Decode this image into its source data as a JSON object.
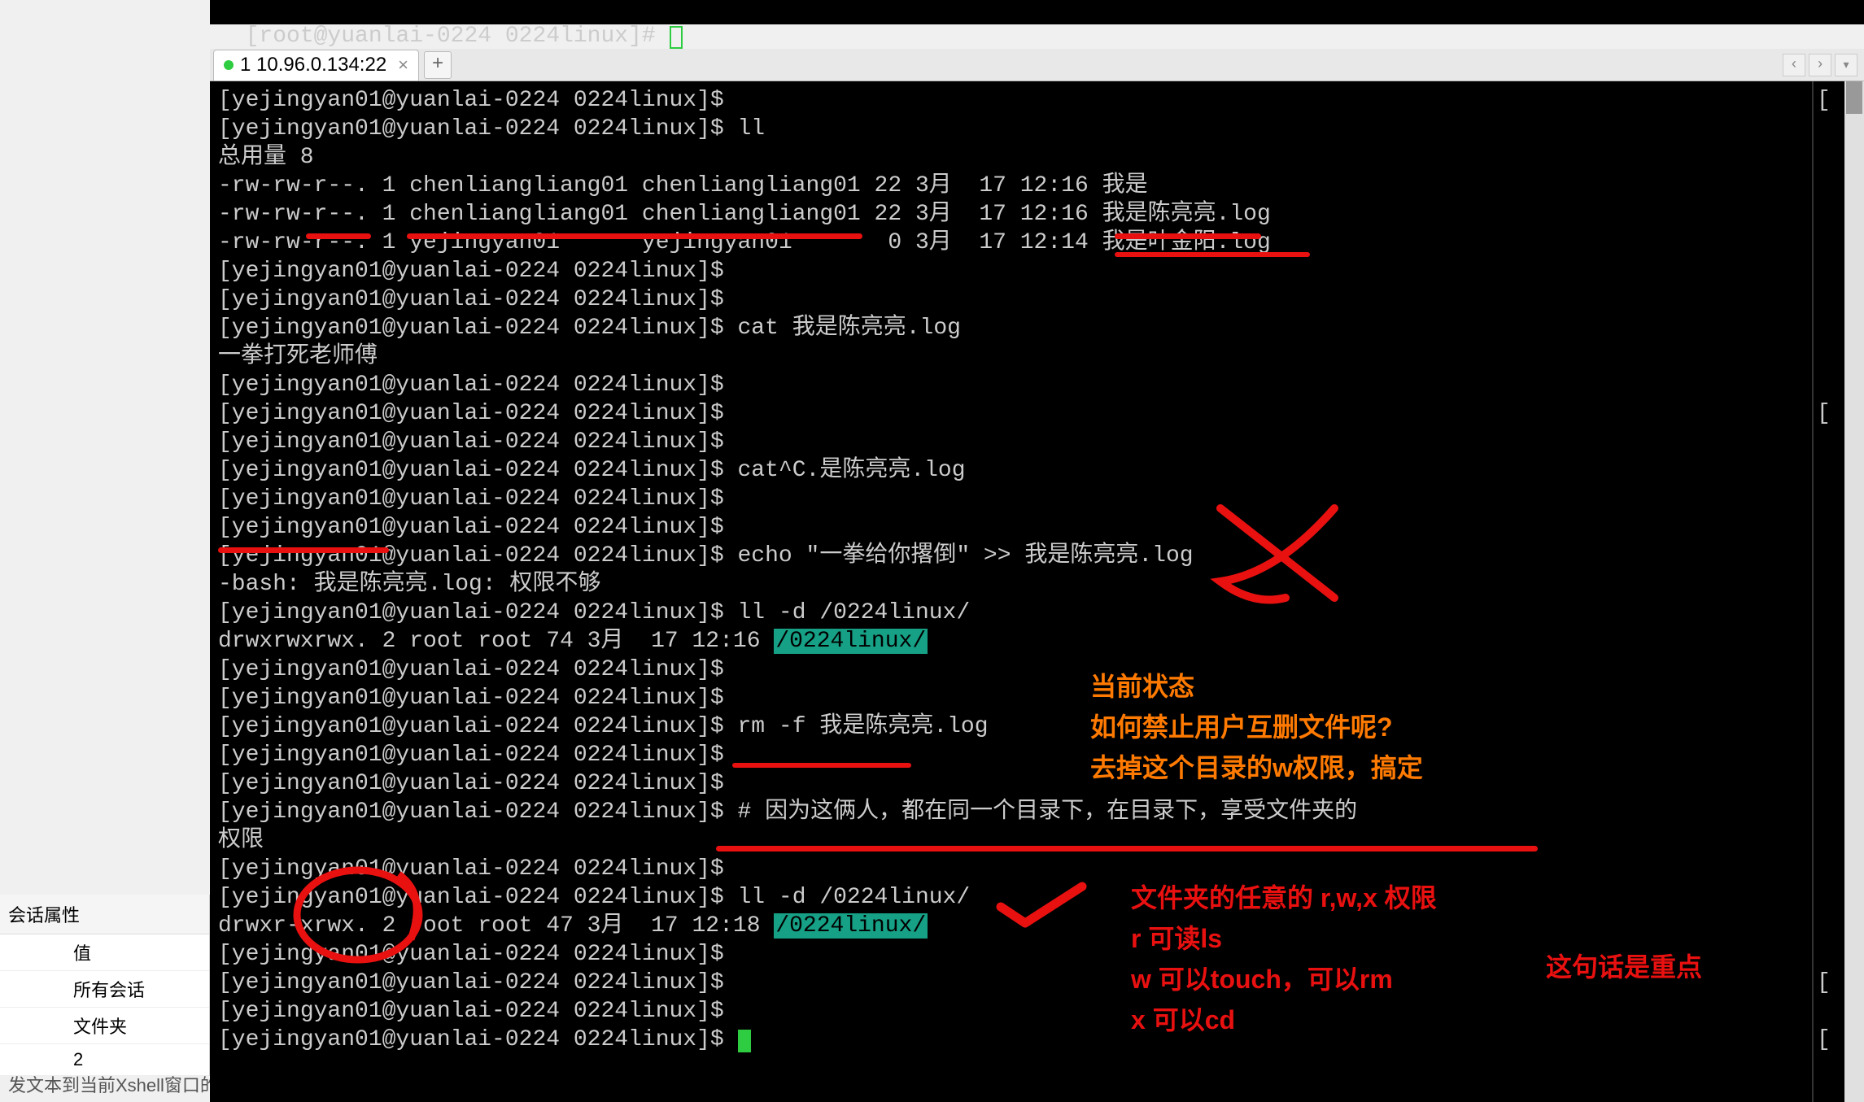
{
  "top_prompt": "[root@yuanlai-0224 0224linux]# ",
  "tab": {
    "label": "1 10.96.0.134:22"
  },
  "panel": {
    "header": "会话属性",
    "col_value": "值",
    "rows": [
      "所有会话",
      "文件夹",
      "2"
    ]
  },
  "bottom_status": "发文本到当前Xshell窗口的全部会话",
  "lines": [
    {
      "t": "[yejingyan01@yuanlai-0224 0224linux]$"
    },
    {
      "t": "[yejingyan01@yuanlai-0224 0224linux]$ ll"
    },
    {
      "t": "总用量 8"
    },
    {
      "t": "-rw-rw-r--. 1 chenliangliang01 chenliangliang01 22 3月  17 12:16 我是"
    },
    {
      "t": "-rw-rw-r--. 1 chenliangliang01 chenliangliang01 22 3月  17 12:16 我是陈亮亮.log"
    },
    {
      "t": "-rw-rw-r--. 1 yejingyan01      yejingyan01       0 3月  17 12:14 我是叶金阳.log"
    },
    {
      "t": "[yejingyan01@yuanlai-0224 0224linux]$"
    },
    {
      "t": "[yejingyan01@yuanlai-0224 0224linux]$"
    },
    {
      "t": "[yejingyan01@yuanlai-0224 0224linux]$ cat 我是陈亮亮.log"
    },
    {
      "t": "一拳打死老师傅"
    },
    {
      "t": "[yejingyan01@yuanlai-0224 0224linux]$"
    },
    {
      "t": "[yejingyan01@yuanlai-0224 0224linux]$"
    },
    {
      "t": "[yejingyan01@yuanlai-0224 0224linux]$"
    },
    {
      "t": "[yejingyan01@yuanlai-0224 0224linux]$ cat^C.是陈亮亮.log"
    },
    {
      "t": "[yejingyan01@yuanlai-0224 0224linux]$"
    },
    {
      "t": "[yejingyan01@yuanlai-0224 0224linux]$"
    },
    {
      "t": "[yejingyan01@yuanlai-0224 0224linux]$ echo \"一拳给你撂倒\" >> 我是陈亮亮.log"
    },
    {
      "t": "-bash: 我是陈亮亮.log: 权限不够"
    },
    {
      "t": "[yejingyan01@yuanlai-0224 0224linux]$ ll -d /0224linux/"
    },
    {
      "prefix": "drwxrwxrwx. 2 root root 74 3月  17 12:16 ",
      "hl": "/0224linux/"
    },
    {
      "t": "[yejingyan01@yuanlai-0224 0224linux]$"
    },
    {
      "t": "[yejingyan01@yuanlai-0224 0224linux]$"
    },
    {
      "t": "[yejingyan01@yuanlai-0224 0224linux]$ rm -f 我是陈亮亮.log"
    },
    {
      "t": "[yejingyan01@yuanlai-0224 0224linux]$"
    },
    {
      "t": "[yejingyan01@yuanlai-0224 0224linux]$"
    },
    {
      "t": "[yejingyan01@yuanlai-0224 0224linux]$ # 因为这俩人，都在同一个目录下，在目录下，享受文件夹的"
    },
    {
      "t": "权限"
    },
    {
      "t": "[yejingyan01@yuanlai-0224 0224linux]$"
    },
    {
      "t": "[yejingyan01@yuanlai-0224 0224linux]$ ll -d /0224linux/"
    },
    {
      "prefix": "drwxr-xrwx. 2 root root 47 3月  17 12:18 ",
      "hl": "/0224linux/"
    },
    {
      "t": "[yejingyan01@yuanlai-0224 0224linux]$"
    },
    {
      "t": "[yejingyan01@yuanlai-0224 0224linux]$"
    },
    {
      "t": "[yejingyan01@yuanlai-0224 0224linux]$"
    },
    {
      "t": "[yejingyan01@yuanlai-0224 0224linux]$ ",
      "cursor": true
    }
  ],
  "right_edge_chars": [
    "[",
    "",
    "",
    "",
    "",
    "",
    "",
    "",
    "",
    "",
    "",
    "[",
    "",
    "",
    "",
    "",
    "",
    "",
    "",
    "",
    "",
    "",
    "",
    "",
    "",
    "",
    "",
    "",
    "",
    "",
    "",
    "[",
    "",
    "["
  ],
  "annotations": {
    "orange1_l1": "当前状态",
    "orange1_l2": "如何禁止用户互删文件呢?",
    "orange1_l3": "去掉这个目录的w权限，搞定",
    "red2_l1": "文件夹的任意的 r,w,x 权限",
    "red2_l2": "r 可读ls",
    "red2_l3": "w  可以touch，可以rm",
    "red2_l4": "x 可以cd",
    "red3": "这句话是重点"
  }
}
